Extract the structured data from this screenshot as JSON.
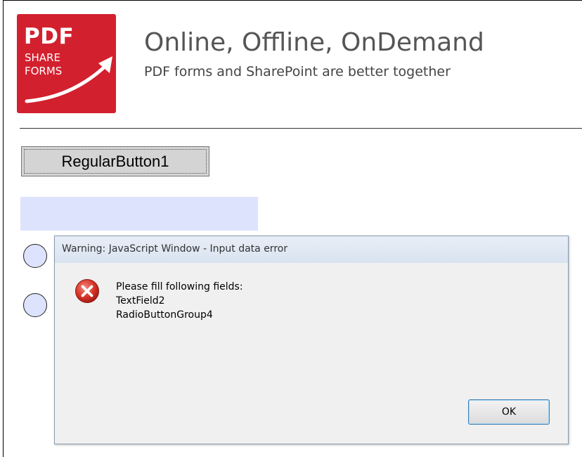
{
  "header": {
    "logo": {
      "line1": "PDF",
      "line2": "SHARE",
      "line3": "FORMS",
      "color": "#d3202e"
    },
    "title": "Online, Offline, OnDemand",
    "subtitle": "PDF forms and SharePoint are better together"
  },
  "form": {
    "regular_button_label": "RegularButton1",
    "text_field_value": "",
    "field_color": "#dde3fd"
  },
  "dialog": {
    "title": "Warning: JavaScript Window - Input data error",
    "icon": "error-icon",
    "message_lines": [
      "Please fill following fields:",
      "TextField2",
      "RadioButtonGroup4"
    ],
    "ok_label": "OK"
  }
}
